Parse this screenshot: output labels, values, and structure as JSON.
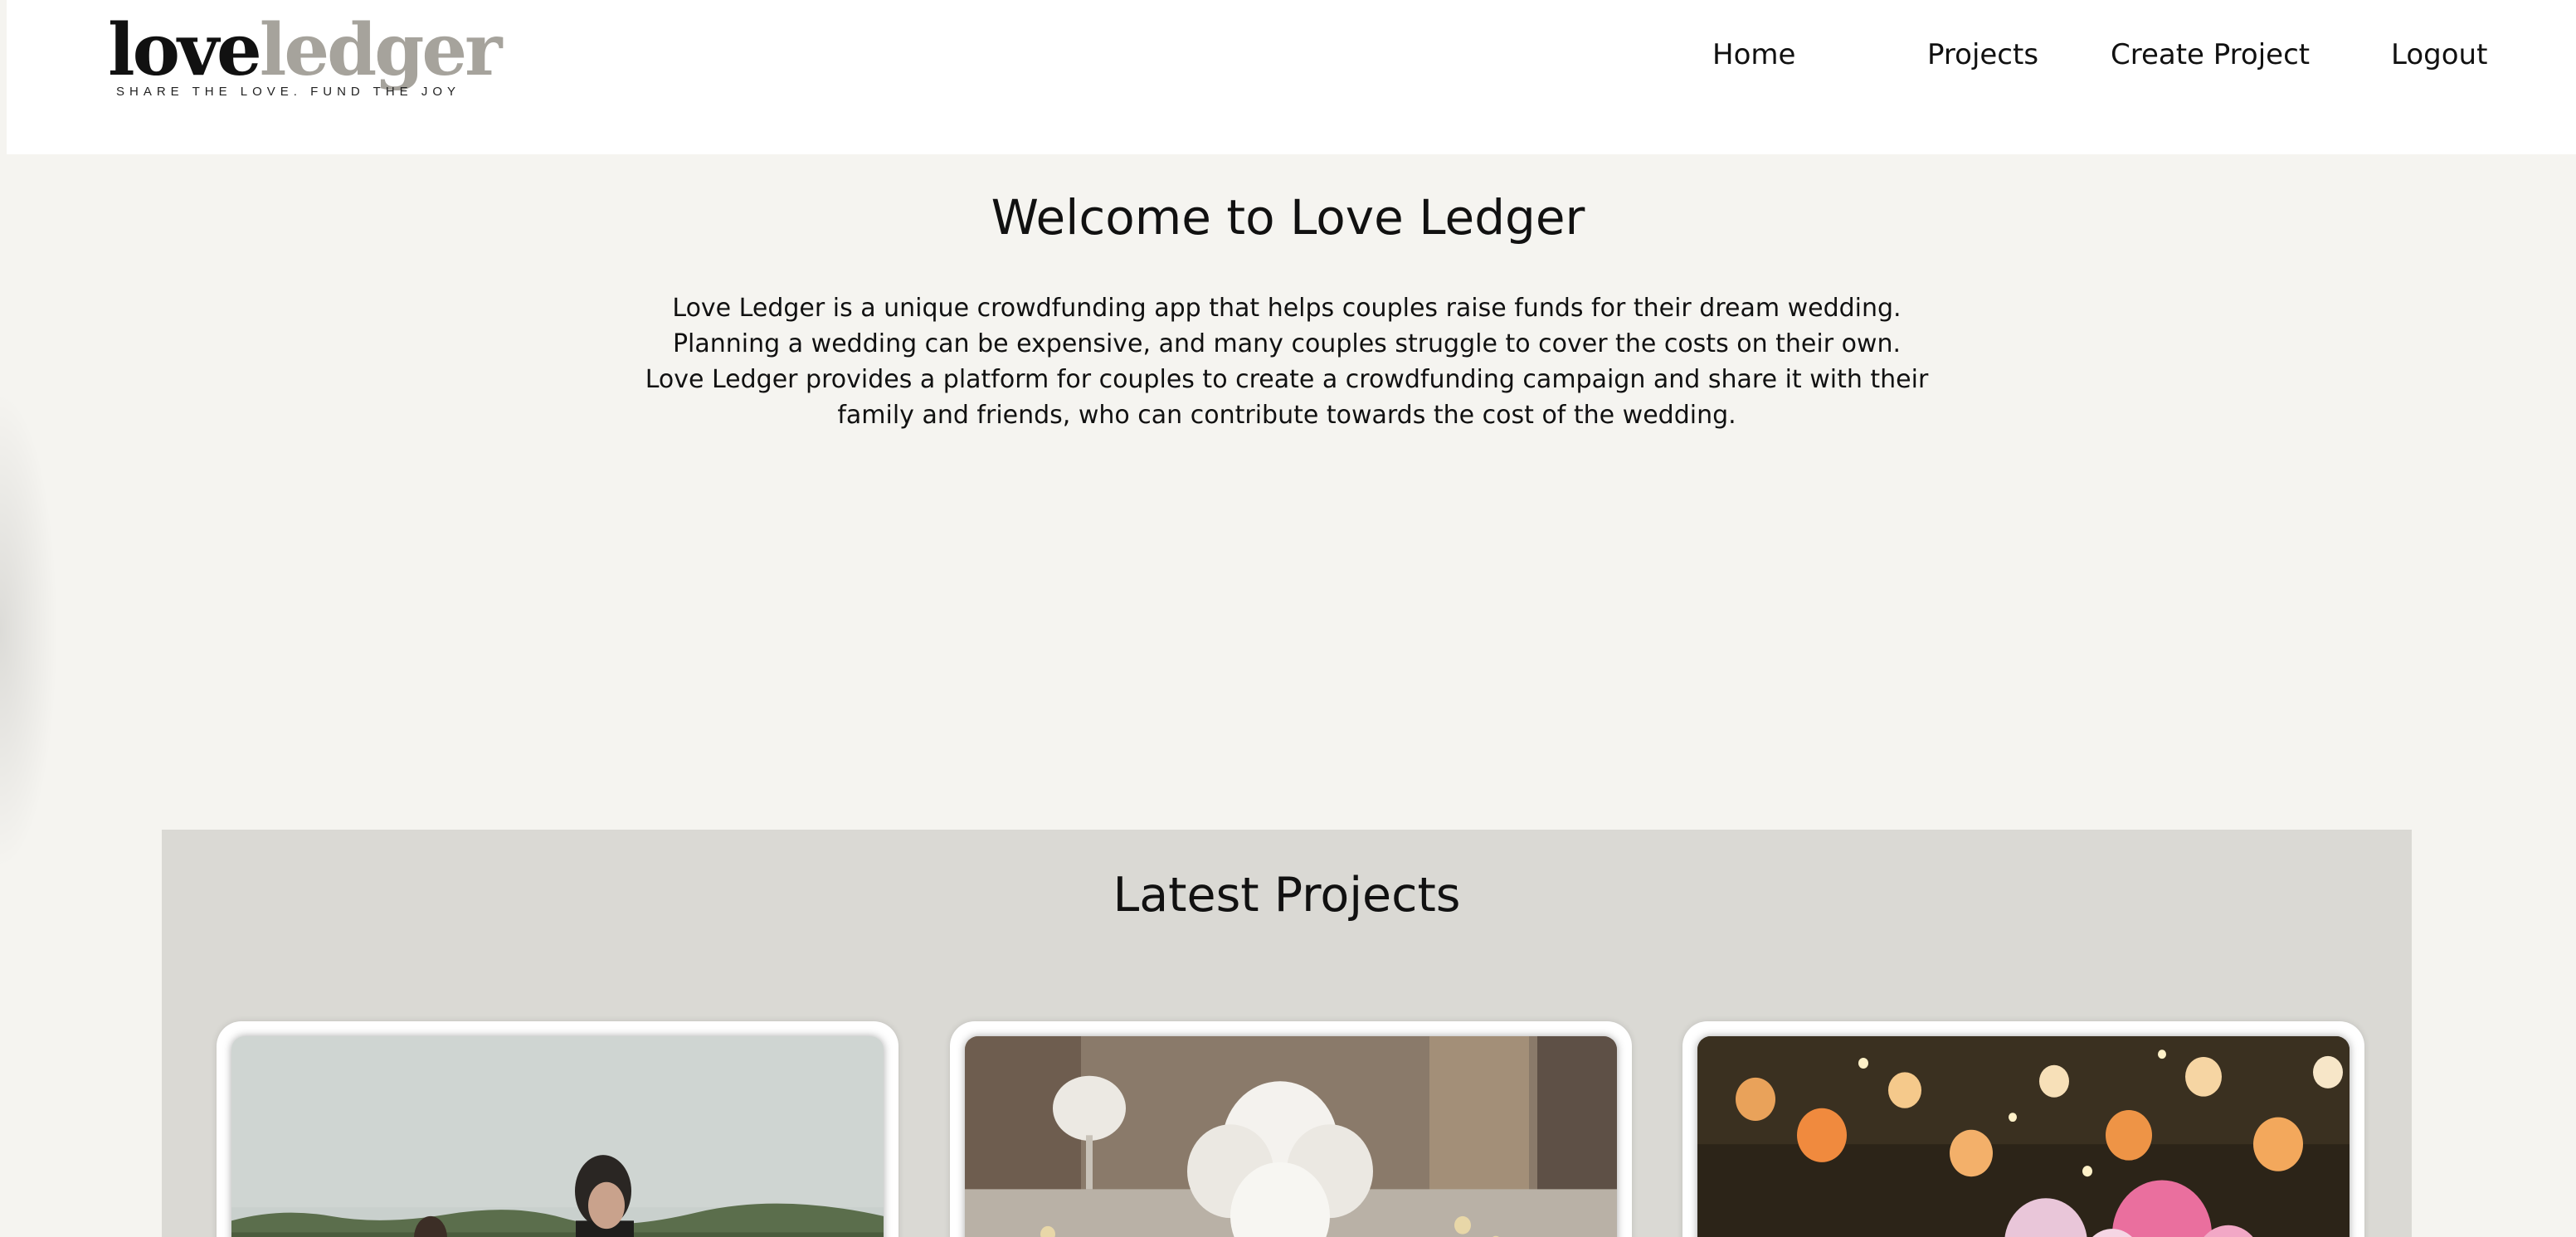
{
  "header": {
    "logo": {
      "word_dark": "love",
      "word_light": "ledger",
      "tagline": "SHARE THE LOVE. FUND THE JOY"
    },
    "nav": [
      "Home",
      "Projects",
      "Create Project",
      "Logout"
    ]
  },
  "intro": {
    "title": "Welcome to Love Ledger",
    "description": "Love Ledger is a unique crowdfunding app that helps couples raise funds for their dream wedding. Planning a wedding can be expensive, and many couples struggle to cover the costs on their own. Love Ledger provides a platform for couples to create a crowdfunding campaign and share it with their family and friends, who can contribute towards the cost of the wedding."
  },
  "latest": {
    "title": "Latest Projects",
    "cards": [
      {
        "image": "couple-outdoor-photo"
      },
      {
        "image": "white-flower-centerpiece-photo"
      },
      {
        "image": "lanterns-and-pink-flowers-photo"
      }
    ]
  },
  "colors": {
    "page_bg": "#f5f4f0",
    "header_bg": "#ffffff",
    "section_bg": "#dad9d4",
    "logo_light": "#a6a39c",
    "text": "#111111"
  }
}
